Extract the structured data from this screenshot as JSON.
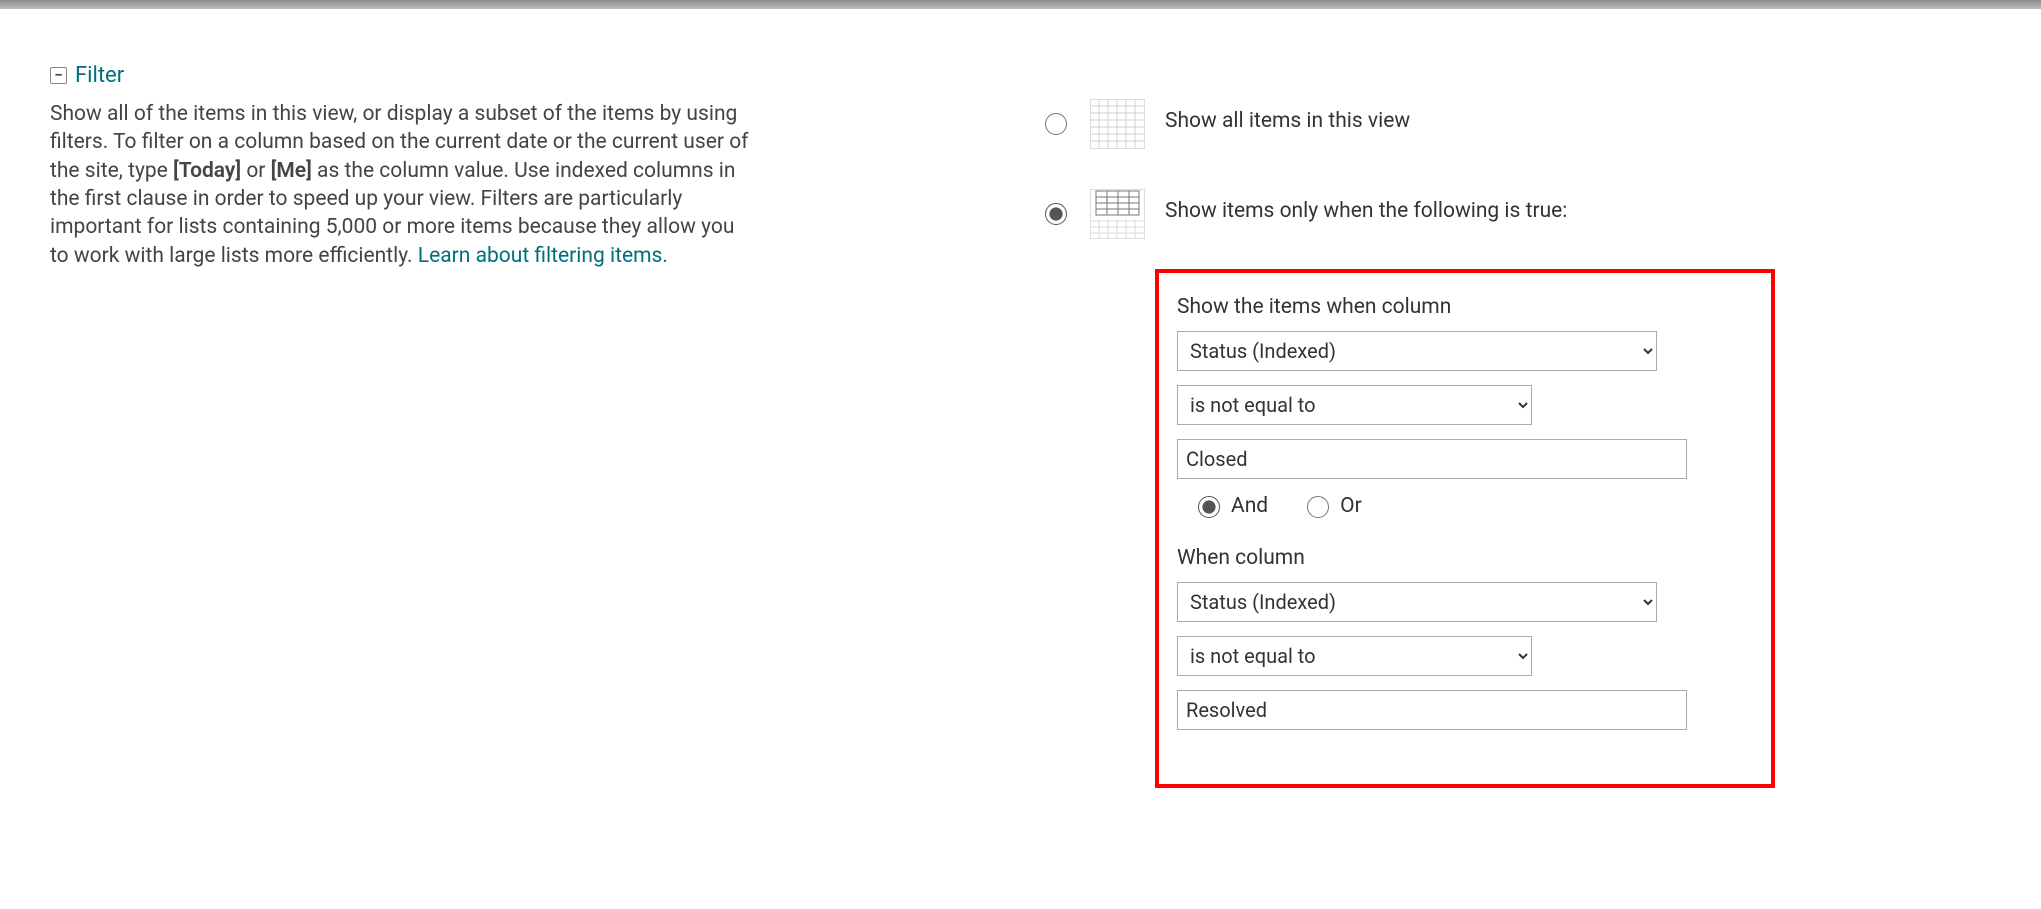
{
  "section": {
    "title": "Filter",
    "desc_pre": "Show all of the items in this view, or display a subset of the items by using filters. To filter on a column based on the current date or the current user of the site, type ",
    "desc_token1": "[Today]",
    "desc_mid1": " or ",
    "desc_token2": "[Me]",
    "desc_mid2": " as the column value. Use indexed columns in the first clause in order to speed up your view. Filters are particularly important for lists containing 5,000 or more items because they allow you to work with large lists more efficiently. ",
    "desc_link": "Learn about filtering items."
  },
  "options": {
    "show_all": "Show all items in this view",
    "show_when": "Show items only when the following is true:"
  },
  "filter": {
    "heading": "Show the items when column",
    "clause1": {
      "column": "Status (Indexed)",
      "operator": "is not equal to",
      "value": "Closed"
    },
    "logic": {
      "and": "And",
      "or": "Or",
      "selected": "and"
    },
    "heading2": "When column",
    "clause2": {
      "column": "Status (Indexed)",
      "operator": "is not equal to",
      "value": "Resolved"
    }
  }
}
